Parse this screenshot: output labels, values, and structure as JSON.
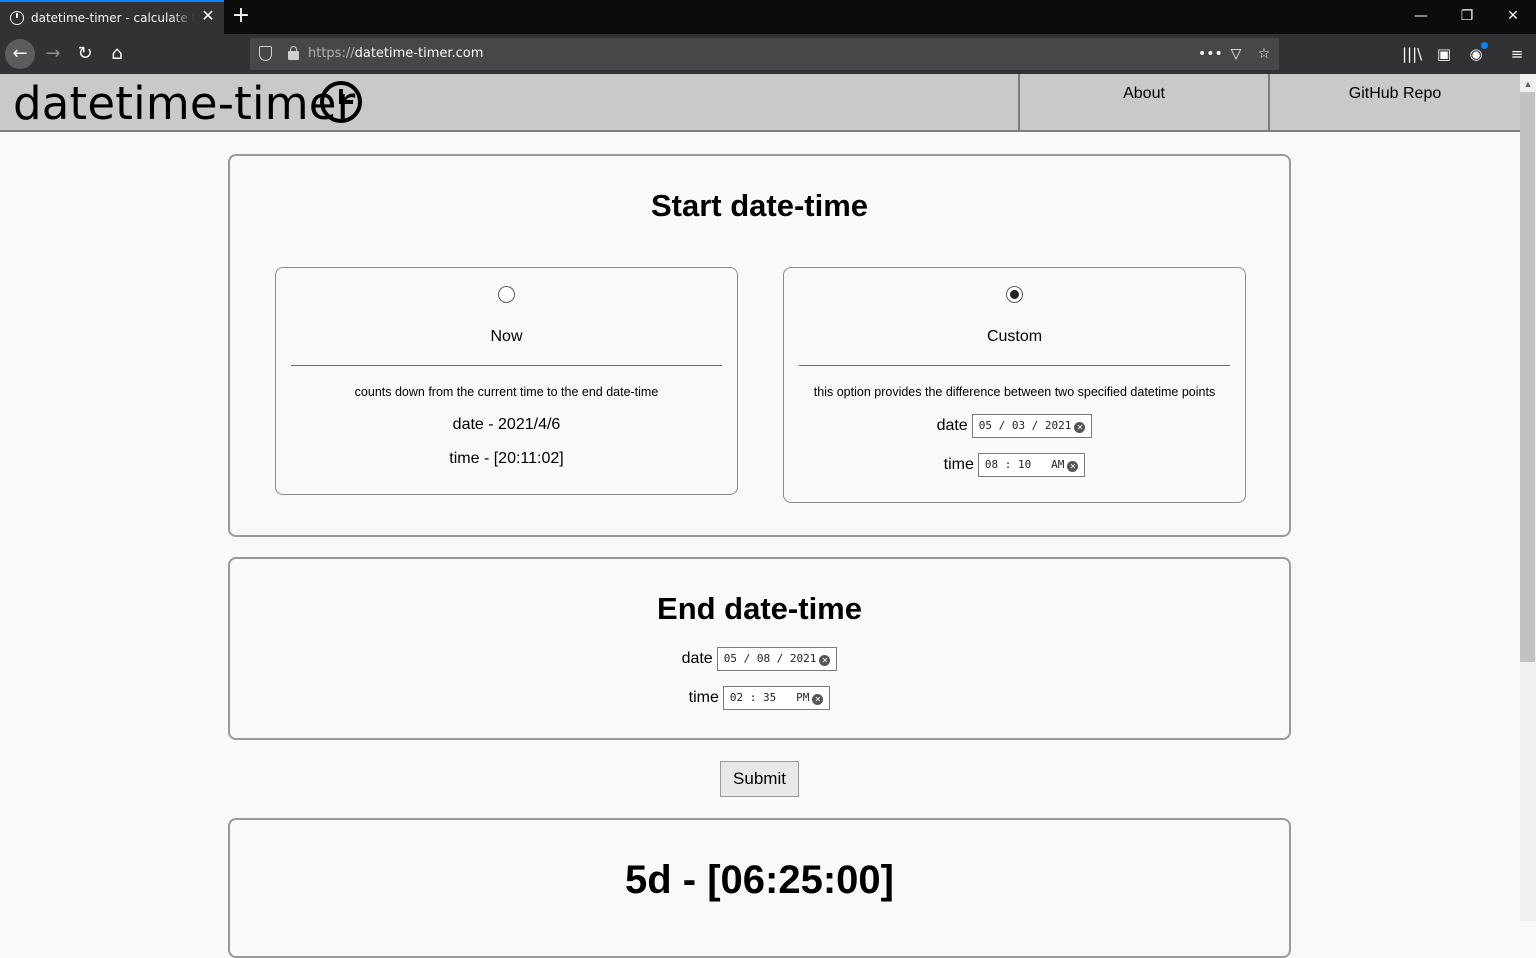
{
  "browser": {
    "tab_title": "datetime-timer - calculate time",
    "tab_close": "✕",
    "new_tab": "+",
    "window": {
      "minimize": "—",
      "restore": "❐",
      "close": "✕"
    },
    "nav": {
      "back": "←",
      "forward": "→",
      "reload": "↻",
      "home": "⌂"
    },
    "url_protocol": "https://",
    "url_host": "datetime-timer.com",
    "url_actions": {
      "more": "•••",
      "pocket": "▽",
      "bookmark": "☆"
    },
    "toolbar": {
      "library": "|||\\",
      "sidebar": "▣",
      "account": "◉",
      "menu": "≡"
    }
  },
  "header": {
    "brand": "datetime-timer",
    "links": {
      "about": "About",
      "github": "GitHub Repo"
    }
  },
  "start": {
    "title": "Start date-time",
    "now": {
      "label": "Now",
      "selected": false,
      "description": "counts down from the current time to the end date-time",
      "date_line": "date - 2021/4/6",
      "time_line": "time - [20:11:02]"
    },
    "custom": {
      "label": "Custom",
      "selected": true,
      "description": "this option provides the difference between two specified datetime points",
      "date_label": "date",
      "date_value": "05 / 03 / 2021",
      "time_label": "time",
      "time_value": "08 : 10   AM"
    }
  },
  "end": {
    "title": "End date-time",
    "date_label": "date",
    "date_value": "05 / 08 / 2021",
    "time_label": "time",
    "time_value": "02 : 35   PM"
  },
  "submit_label": "Submit",
  "result": "5d - [06:25:00]",
  "clear_glyph": "✕",
  "scroll_up": "▲",
  "colors": {
    "tab_accent": "#0a84ff",
    "header_bg": "#c9c9c9",
    "chrome_dark": "#0c0c0d",
    "chrome_toolbar": "#323234"
  }
}
